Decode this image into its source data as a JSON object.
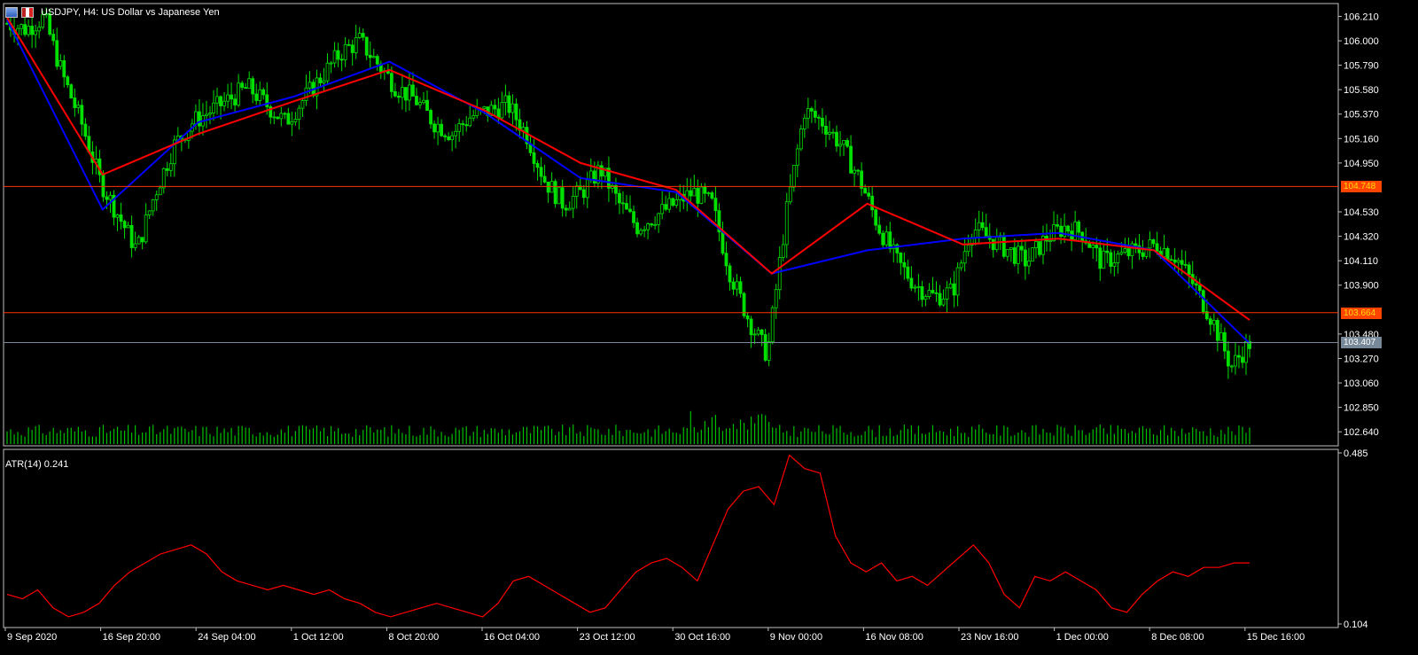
{
  "window": {
    "title": "USDJPY, H4:  US Dollar vs Japanese Yen",
    "icons": [
      "chart-window-icon",
      "usd-flag-icon"
    ]
  },
  "indicator": {
    "label": "ATR(14) 0.241"
  },
  "colors": {
    "background": "#000000",
    "grid_line": "#ffffff",
    "candle": "#00e000",
    "volume": "#00c000",
    "ma_fast": "#0000ff",
    "ma_slow": "#ff0000",
    "atr_line": "#ff0000",
    "level_line": "#ff3300",
    "level_tag": "#ff4400",
    "current_tag": "#778899"
  },
  "price_tags": {
    "level_high": "104.748",
    "level_low": "103.664",
    "current": "103.407"
  },
  "chart_data": [
    {
      "type": "candlestick",
      "title": "USDJPY, H4:  US Dollar vs Japanese Yen",
      "y_ticks": [
        "106.210",
        "106.000",
        "105.790",
        "105.580",
        "105.370",
        "105.160",
        "104.950",
        "104.530",
        "104.320",
        "104.110",
        "103.900",
        "103.480",
        "103.270",
        "103.060",
        "102.850",
        "102.640"
      ],
      "ylim": [
        102.55,
        106.32
      ],
      "x_ticks": [
        "9 Sep 2020",
        "16 Sep 20:00",
        "24 Sep 04:00",
        "1 Oct 12:00",
        "8 Oct 20:00",
        "16 Oct 04:00",
        "23 Oct 12:00",
        "30 Oct 16:00",
        "9 Nov 00:00",
        "16 Nov 08:00",
        "23 Nov 16:00",
        "1 Dec 00:00",
        "8 Dec 08:00",
        "15 Dec 16:00"
      ],
      "horizontal_lines": [
        104.748,
        103.664,
        103.407
      ],
      "series": [
        {
          "name": "",
          "color": "#0000ff",
          "x": [
            "9 Sep 2020",
            "16 Sep 20:00",
            "24 Sep 04:00",
            "1 Oct 12:00",
            "8 Oct 20:00",
            "16 Oct 04:00",
            "23 Oct 12:00",
            "30 Oct 16:00",
            "9 Nov 00:00",
            "16 Nov 08:00",
            "23 Nov 16:00",
            "1 Dec 00:00",
            "8 Dec 08:00",
            "15 Dec 16:00"
          ],
          "values": [
            106.18,
            104.55,
            105.3,
            105.52,
            105.82,
            105.38,
            104.82,
            104.7,
            104.0,
            104.2,
            104.3,
            104.35,
            104.2,
            103.4
          ]
        },
        {
          "name": "",
          "color": "#ff0000",
          "x": [
            "9 Sep 2020",
            "16 Sep 20:00",
            "24 Sep 04:00",
            "1 Oct 12:00",
            "8 Oct 20:00",
            "16 Oct 04:00",
            "23 Oct 12:00",
            "30 Oct 16:00",
            "9 Nov 00:00",
            "16 Nov 08:00",
            "23 Nov 16:00",
            "1 Dec 00:00",
            "8 Dec 08:00",
            "15 Dec 16:00"
          ],
          "values": [
            106.2,
            104.85,
            105.2,
            105.48,
            105.75,
            105.4,
            104.95,
            104.72,
            104.0,
            104.6,
            104.25,
            104.3,
            104.2,
            103.6
          ]
        }
      ],
      "price_path": [
        106.15,
        106.1,
        106.2,
        105.7,
        105.3,
        104.8,
        104.5,
        104.2,
        104.7,
        105.1,
        105.3,
        105.4,
        105.5,
        105.6,
        105.45,
        105.3,
        105.5,
        105.7,
        105.9,
        106.0,
        105.8,
        105.6,
        105.5,
        105.3,
        105.2,
        105.35,
        105.4,
        105.45,
        105.2,
        104.8,
        104.6,
        104.7,
        104.9,
        104.6,
        104.4,
        104.5,
        104.6,
        104.7,
        104.6,
        104.0,
        103.6,
        103.3,
        104.5,
        105.4,
        105.3,
        105.1,
        104.8,
        104.4,
        104.1,
        103.9,
        103.8,
        103.85,
        104.4,
        104.3,
        104.2,
        104.1,
        104.3,
        104.4,
        104.35,
        104.1,
        104.15,
        104.2,
        104.25,
        104.15,
        103.9,
        103.6,
        103.2,
        103.4
      ]
    },
    {
      "type": "line",
      "title": "ATR(14) 0.241",
      "y_ticks": [
        "0.485",
        "0.104"
      ],
      "ylim": [
        0.104,
        0.485
      ],
      "series": [
        {
          "name": "ATR(14)",
          "color": "#ff0000",
          "values": [
            0.17,
            0.16,
            0.18,
            0.14,
            0.12,
            0.13,
            0.15,
            0.19,
            0.22,
            0.24,
            0.26,
            0.27,
            0.28,
            0.26,
            0.22,
            0.2,
            0.19,
            0.18,
            0.19,
            0.18,
            0.17,
            0.18,
            0.16,
            0.15,
            0.13,
            0.12,
            0.13,
            0.14,
            0.15,
            0.14,
            0.13,
            0.12,
            0.15,
            0.2,
            0.21,
            0.19,
            0.17,
            0.15,
            0.13,
            0.14,
            0.18,
            0.22,
            0.24,
            0.25,
            0.23,
            0.2,
            0.28,
            0.36,
            0.4,
            0.41,
            0.37,
            0.48,
            0.45,
            0.44,
            0.3,
            0.24,
            0.22,
            0.24,
            0.2,
            0.21,
            0.19,
            0.22,
            0.25,
            0.28,
            0.24,
            0.17,
            0.14,
            0.21,
            0.2,
            0.22,
            0.2,
            0.18,
            0.14,
            0.13,
            0.17,
            0.2,
            0.22,
            0.21,
            0.23,
            0.23,
            0.24,
            0.24
          ]
        }
      ]
    }
  ]
}
